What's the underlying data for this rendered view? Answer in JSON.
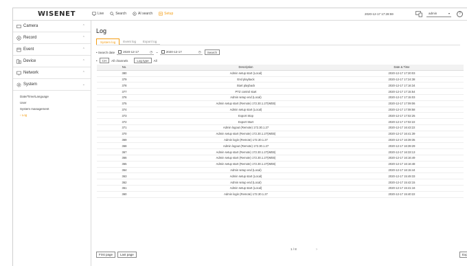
{
  "header": {
    "logo": "WISENET",
    "menu": [
      {
        "label": "Live",
        "icon": "monitor-icon",
        "active": false
      },
      {
        "label": "Search",
        "icon": "search-icon",
        "active": false
      },
      {
        "label": "AI search",
        "icon": "ai-search-icon",
        "active": false
      },
      {
        "label": "Setup",
        "icon": "setup-icon",
        "active": true
      }
    ],
    "datetime": "2020-12-17 17:28:59",
    "user": "admin",
    "help": "?"
  },
  "sidebar": {
    "items": [
      {
        "label": "Camera",
        "icon": "camera-icon"
      },
      {
        "label": "Record",
        "icon": "record-icon"
      },
      {
        "label": "Event",
        "icon": "event-icon"
      },
      {
        "label": "Device",
        "icon": "device-icon"
      },
      {
        "label": "Network",
        "icon": "network-icon"
      },
      {
        "label": "System",
        "icon": "system-icon"
      }
    ],
    "subitems": [
      "Date/Time/Language",
      "User",
      "System management",
      "Log"
    ],
    "active_subitem": "Log"
  },
  "main": {
    "title": "Log",
    "tabs": [
      "System log",
      "Event log",
      "Export log"
    ],
    "active_tab": "System log",
    "search": {
      "label": "Search date",
      "from": "2020-12-17",
      "sep": "~",
      "to": "2020-12-17",
      "button": "Search"
    },
    "filter": {
      "ch_button": "CH",
      "ch_value": "All channels",
      "type_button": "Log type",
      "type_value": "All"
    },
    "columns": {
      "no": "No.",
      "desc": "Description",
      "date": "Date & Time"
    },
    "rows": [
      {
        "no": "380",
        "desc": "Admin setup start (Local)",
        "date": "2020-12-17 17:20:03"
      },
      {
        "no": "379",
        "desc": "End playback",
        "date": "2020-12-17 17:24:38"
      },
      {
        "no": "378",
        "desc": "Start playback",
        "date": "2020-12-17 17:16:34"
      },
      {
        "no": "377",
        "desc": "PTZ control start",
        "date": "2020-12-17 17:15:54"
      },
      {
        "no": "376",
        "desc": "Admin setup end (Local)",
        "date": "2020-12-17 17:15:03"
      },
      {
        "no": "375",
        "desc": "Admin setup start (Remote) 172.30.1.27(WEB)",
        "date": "2020-12-17 17:09:06"
      },
      {
        "no": "374",
        "desc": "Admin setup start (Local)",
        "date": "2020-12-17 17:08:58"
      },
      {
        "no": "373",
        "desc": "Export Stop",
        "date": "2020-12-17 17:02:25"
      },
      {
        "no": "372",
        "desc": "Export Start",
        "date": "2020-12-17 17:02:22"
      },
      {
        "no": "371",
        "desc": "Admin logout (Remote) 172.30.1.27",
        "date": "2020-12-17 16:43:22"
      },
      {
        "no": "370",
        "desc": "Admin setup start (Remote) 172.30.1.27(WEB)",
        "date": "2020-12-17 16:41:39"
      },
      {
        "no": "369",
        "desc": "Admin login (Remote) 172.30.1.27",
        "date": "2020-12-17 16:39:35"
      },
      {
        "no": "368",
        "desc": "Admin logout (Remote) 172.30.1.27",
        "date": "2020-12-17 16:39:29"
      },
      {
        "no": "367",
        "desc": "Admin setup start (Remote) 172.30.1.27(WEB)",
        "date": "2020-12-17 16:33:13"
      },
      {
        "no": "366",
        "desc": "Admin setup start (Remote) 172.30.1.27(WEB)",
        "date": "2020-12-17 16:16:49"
      },
      {
        "no": "365",
        "desc": "Admin setup start (Remote) 172.30.1.27(WEB)",
        "date": "2020-12-17 16:16:48"
      },
      {
        "no": "364",
        "desc": "Admin setup end (Local)",
        "date": "2020-12-17 16:15:44"
      },
      {
        "no": "363",
        "desc": "Admin setup start (Local)",
        "date": "2020-12-17 15:49:33"
      },
      {
        "no": "362",
        "desc": "Admin setup end (Local)",
        "date": "2020-12-17 15:42:15"
      },
      {
        "no": "361",
        "desc": "Admin setup start (Local)",
        "date": "2020-12-17 15:41:16"
      },
      {
        "no": "360",
        "desc": "Admin login (Remote) 172.30.1.27",
        "date": "2020-12-17 15:40:22"
      }
    ],
    "pager": {
      "page": "1 / 8",
      "next": ">"
    },
    "buttons": {
      "first": "First page",
      "last": "Last page",
      "export": "Export"
    }
  }
}
